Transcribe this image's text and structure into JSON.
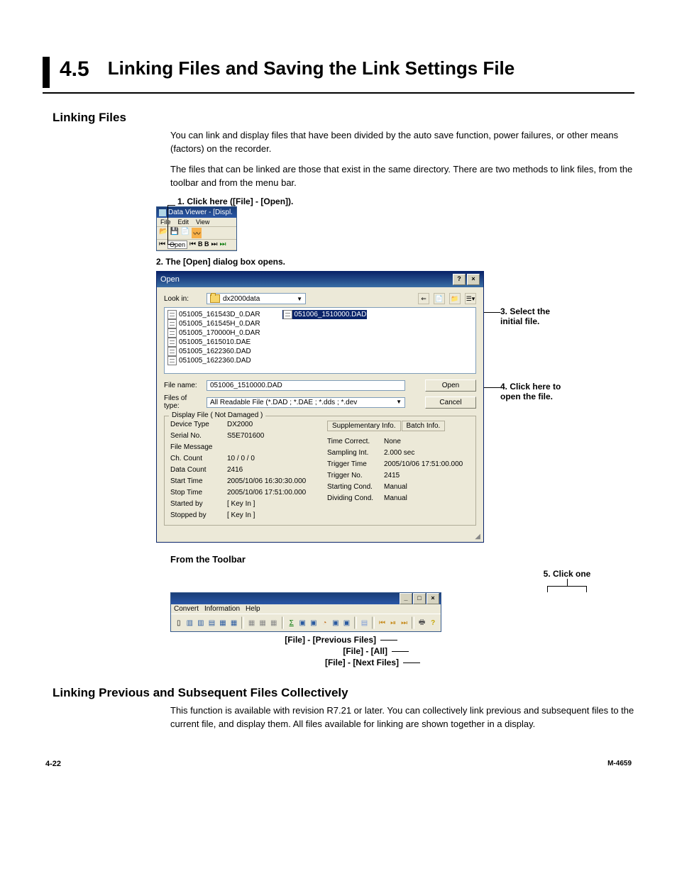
{
  "page": {
    "section_number": "4.5",
    "section_title": "Linking Files and Saving the Link Settings File",
    "footer_left": "4-22",
    "footer_right": "M-4659"
  },
  "h2_linking": "Linking Files",
  "p1": "You can link and display files that have been divided by the auto save function, power failures, or other means (factors) on the recorder.",
  "p2": "The files that can be linked are those that exist in the same directory.  There are two methods to link files, from the toolbar and from the menu bar.",
  "step1": "1. Click here ([File] - [Open]).",
  "mini": {
    "title": "Data Viewer - [Displ.",
    "file": "File",
    "edit": "Edit",
    "view": "View",
    "open_btn": "Open",
    "letters": "B B"
  },
  "step2": "2. The [Open] dialog box opens.",
  "callout3a": "3. Select the",
  "callout3b": "initial file.",
  "callout4a": "4. Click here to",
  "callout4b": "open the file.",
  "dialog": {
    "title": "Open",
    "lookin_label": "Look in:",
    "lookin_value": "dx2000data",
    "files_left": [
      "051005_161543D_0.DAR",
      "051005_161545H_0.DAR",
      "051005_170000H_0.DAR",
      "051005_1615010.DAE",
      "051005_1622360.DAD",
      "051005_1622360.DAD"
    ],
    "files_right_selected": "051006_1510000.DAD",
    "filename_label": "File name:",
    "filename_value": "051006_1510000.DAD",
    "filetype_label": "Files of type:",
    "filetype_value": "All Readable File (*.DAD ; *.DAE ; *.dds ; *.dev",
    "open_btn": "Open",
    "cancel_btn": "Cancel",
    "group_title": "Display File ( Not Damaged )",
    "tab_supp": "Supplementary Info.",
    "tab_batch": "Batch Info.",
    "left": {
      "DeviceType": "DX2000",
      "SerialNo": "S5E701600",
      "FileMessage": "",
      "ChCount": "10 /  0 /  0",
      "DataCount": "2416",
      "StartTime": "2005/10/06 16:30:30.000",
      "StopTime": "2005/10/06 17:51:00.000",
      "StartedBy": "[ Key In ]",
      "StoppedBy": "[ Key In ]"
    },
    "left_labels": {
      "DeviceType": "Device Type",
      "SerialNo": "Serial No.",
      "FileMessage": "File Message",
      "ChCount": "Ch. Count",
      "DataCount": "Data Count",
      "StartTime": "Start Time",
      "StopTime": "Stop Time",
      "StartedBy": "Started by",
      "StoppedBy": "Stopped by"
    },
    "right": {
      "TimeCorrect": "None",
      "SamplingInt": "2.000 sec",
      "TriggerTime": "2005/10/06 17:51:00.000",
      "TriggerNo": "2415",
      "StartingCond": "Manual",
      "DividingCond": "Manual"
    },
    "right_labels": {
      "TimeCorrect": "Time Correct.",
      "SamplingInt": "Sampling Int.",
      "TriggerTime": "Trigger Time",
      "TriggerNo": "Trigger No.",
      "StartingCond": "Starting Cond.",
      "DividingCond": "Dividing Cond."
    }
  },
  "from_toolbar": "From the Toolbar",
  "step5": "5. Click one",
  "toolbar_menu": {
    "convert": "Convert",
    "info": "Information",
    "help": "Help"
  },
  "tb_labels": {
    "prev": "[File] - [Previous Files]",
    "all": "[File] - [All]",
    "next": "[File] - [Next Files]"
  },
  "h2_prev": "Linking Previous and Subsequent Files Collectively",
  "p3": "This function is available with revision R7.21 or later. You can collectively link previous and subsequent files to the current file, and display them. All files available for linking are shown together in a display."
}
